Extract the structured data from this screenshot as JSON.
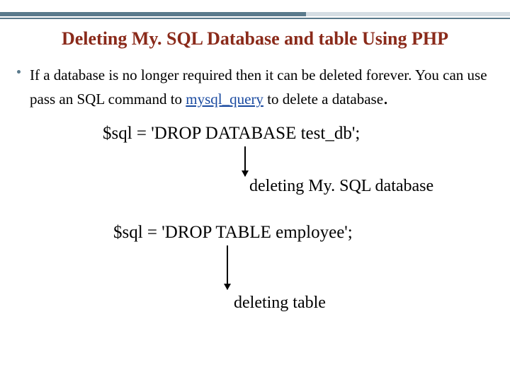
{
  "title": "Deleting My. SQL Database and table Using PHP",
  "bullet": {
    "prefix": "If a database is no longer required then it can be deleted forever. You can use pass an SQL command to ",
    "link": "mysql_query",
    "suffix": " to delete a database"
  },
  "code1": "$sql = 'DROP DATABASE test_db';",
  "annotation1": "deleting My. SQL database",
  "code2": "$sql = 'DROP TABLE employee';",
  "annotation2": "deleting table"
}
